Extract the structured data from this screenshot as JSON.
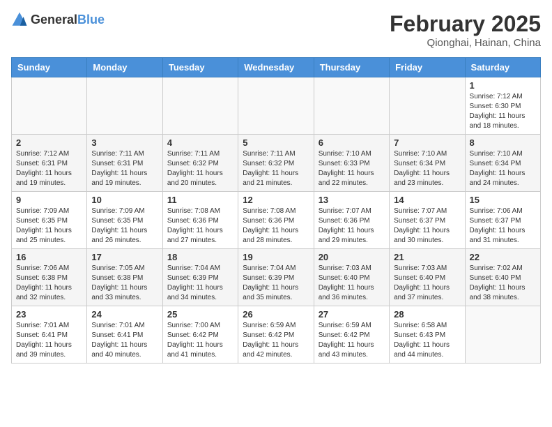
{
  "header": {
    "logo_general": "General",
    "logo_blue": "Blue",
    "title": "February 2025",
    "subtitle": "Qionghai, Hainan, China"
  },
  "columns": [
    "Sunday",
    "Monday",
    "Tuesday",
    "Wednesday",
    "Thursday",
    "Friday",
    "Saturday"
  ],
  "weeks": [
    [
      {
        "day": "",
        "info": ""
      },
      {
        "day": "",
        "info": ""
      },
      {
        "day": "",
        "info": ""
      },
      {
        "day": "",
        "info": ""
      },
      {
        "day": "",
        "info": ""
      },
      {
        "day": "",
        "info": ""
      },
      {
        "day": "1",
        "info": "Sunrise: 7:12 AM\nSunset: 6:30 PM\nDaylight: 11 hours and 18 minutes."
      }
    ],
    [
      {
        "day": "2",
        "info": "Sunrise: 7:12 AM\nSunset: 6:31 PM\nDaylight: 11 hours and 19 minutes."
      },
      {
        "day": "3",
        "info": "Sunrise: 7:11 AM\nSunset: 6:31 PM\nDaylight: 11 hours and 19 minutes."
      },
      {
        "day": "4",
        "info": "Sunrise: 7:11 AM\nSunset: 6:32 PM\nDaylight: 11 hours and 20 minutes."
      },
      {
        "day": "5",
        "info": "Sunrise: 7:11 AM\nSunset: 6:32 PM\nDaylight: 11 hours and 21 minutes."
      },
      {
        "day": "6",
        "info": "Sunrise: 7:10 AM\nSunset: 6:33 PM\nDaylight: 11 hours and 22 minutes."
      },
      {
        "day": "7",
        "info": "Sunrise: 7:10 AM\nSunset: 6:34 PM\nDaylight: 11 hours and 23 minutes."
      },
      {
        "day": "8",
        "info": "Sunrise: 7:10 AM\nSunset: 6:34 PM\nDaylight: 11 hours and 24 minutes."
      }
    ],
    [
      {
        "day": "9",
        "info": "Sunrise: 7:09 AM\nSunset: 6:35 PM\nDaylight: 11 hours and 25 minutes."
      },
      {
        "day": "10",
        "info": "Sunrise: 7:09 AM\nSunset: 6:35 PM\nDaylight: 11 hours and 26 minutes."
      },
      {
        "day": "11",
        "info": "Sunrise: 7:08 AM\nSunset: 6:36 PM\nDaylight: 11 hours and 27 minutes."
      },
      {
        "day": "12",
        "info": "Sunrise: 7:08 AM\nSunset: 6:36 PM\nDaylight: 11 hours and 28 minutes."
      },
      {
        "day": "13",
        "info": "Sunrise: 7:07 AM\nSunset: 6:36 PM\nDaylight: 11 hours and 29 minutes."
      },
      {
        "day": "14",
        "info": "Sunrise: 7:07 AM\nSunset: 6:37 PM\nDaylight: 11 hours and 30 minutes."
      },
      {
        "day": "15",
        "info": "Sunrise: 7:06 AM\nSunset: 6:37 PM\nDaylight: 11 hours and 31 minutes."
      }
    ],
    [
      {
        "day": "16",
        "info": "Sunrise: 7:06 AM\nSunset: 6:38 PM\nDaylight: 11 hours and 32 minutes."
      },
      {
        "day": "17",
        "info": "Sunrise: 7:05 AM\nSunset: 6:38 PM\nDaylight: 11 hours and 33 minutes."
      },
      {
        "day": "18",
        "info": "Sunrise: 7:04 AM\nSunset: 6:39 PM\nDaylight: 11 hours and 34 minutes."
      },
      {
        "day": "19",
        "info": "Sunrise: 7:04 AM\nSunset: 6:39 PM\nDaylight: 11 hours and 35 minutes."
      },
      {
        "day": "20",
        "info": "Sunrise: 7:03 AM\nSunset: 6:40 PM\nDaylight: 11 hours and 36 minutes."
      },
      {
        "day": "21",
        "info": "Sunrise: 7:03 AM\nSunset: 6:40 PM\nDaylight: 11 hours and 37 minutes."
      },
      {
        "day": "22",
        "info": "Sunrise: 7:02 AM\nSunset: 6:40 PM\nDaylight: 11 hours and 38 minutes."
      }
    ],
    [
      {
        "day": "23",
        "info": "Sunrise: 7:01 AM\nSunset: 6:41 PM\nDaylight: 11 hours and 39 minutes."
      },
      {
        "day": "24",
        "info": "Sunrise: 7:01 AM\nSunset: 6:41 PM\nDaylight: 11 hours and 40 minutes."
      },
      {
        "day": "25",
        "info": "Sunrise: 7:00 AM\nSunset: 6:42 PM\nDaylight: 11 hours and 41 minutes."
      },
      {
        "day": "26",
        "info": "Sunrise: 6:59 AM\nSunset: 6:42 PM\nDaylight: 11 hours and 42 minutes."
      },
      {
        "day": "27",
        "info": "Sunrise: 6:59 AM\nSunset: 6:42 PM\nDaylight: 11 hours and 43 minutes."
      },
      {
        "day": "28",
        "info": "Sunrise: 6:58 AM\nSunset: 6:43 PM\nDaylight: 11 hours and 44 minutes."
      },
      {
        "day": "",
        "info": ""
      }
    ]
  ]
}
